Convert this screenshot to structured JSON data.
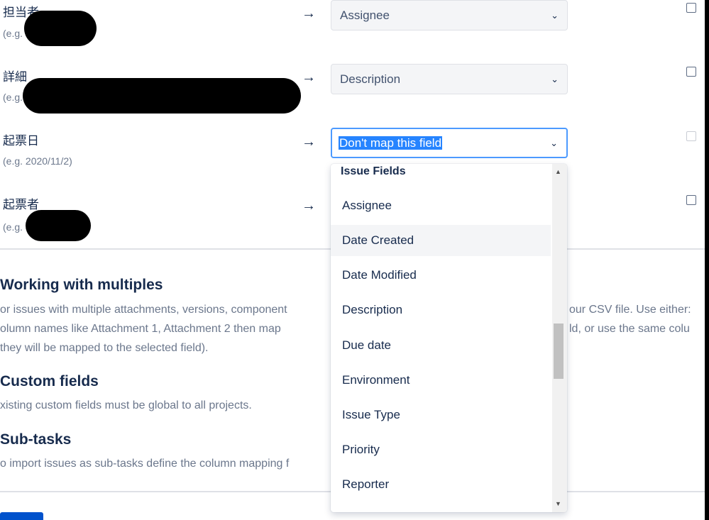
{
  "mapping_rows": [
    {
      "label": "担当者",
      "example": "(e.g.",
      "selected": "Assignee"
    },
    {
      "label": "詳細",
      "example": "(e.g.",
      "selected": "Description"
    },
    {
      "label": "起票日",
      "example": "(e.g. 2020/11/2)",
      "selected": "Don't map this field"
    },
    {
      "label": "起票者",
      "example": "(e.g."
    }
  ],
  "arrow_glyph": "→",
  "chevron_glyph": "⌄",
  "sections": {
    "multiples": {
      "heading": "Working with multiples",
      "line1a": "or issues with multiple attachments, versions, component",
      "line1b": "our CSV file. Use either:",
      "line2a": "olumn names like Attachment 1, Attachment 2 then map",
      "line2b": "ld, or use the same colu",
      "line3": "they will be mapped to the selected field)."
    },
    "custom_fields": {
      "heading": "Custom fields",
      "text": "xisting custom fields must be global to all projects."
    },
    "subtasks": {
      "heading": "Sub-tasks",
      "text": "o import issues as sub-tasks define the column mapping f"
    }
  },
  "dropdown": {
    "group_label": "Issue Fields",
    "options": [
      "Assignee",
      "Date Created",
      "Date Modified",
      "Description",
      "Due date",
      "Environment",
      "Issue Type",
      "Priority",
      "Reporter"
    ],
    "hovered": "Date Created"
  },
  "colors": {
    "accent": "#2684ff",
    "focus_border": "#4c9aff",
    "primary_button": "#0052cc",
    "text": "#172b4d",
    "muted_text": "#6b778c"
  }
}
